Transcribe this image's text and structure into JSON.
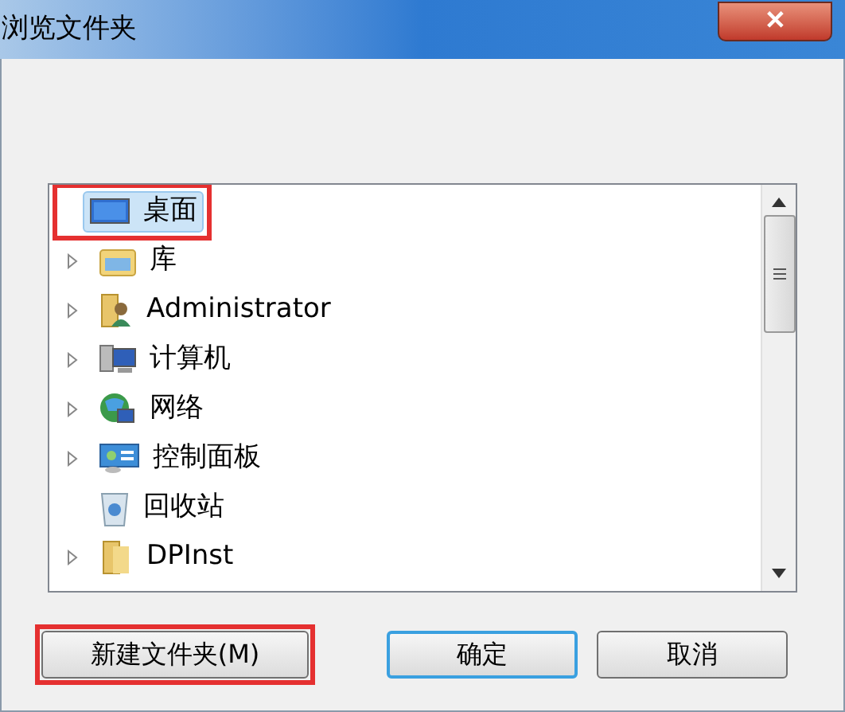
{
  "window": {
    "title": "浏览文件夹",
    "close_label": "✕"
  },
  "tree": {
    "items": [
      {
        "label": "桌面",
        "kind": "desktop",
        "selected": true,
        "expandable": false,
        "highlighted": true
      },
      {
        "label": "库",
        "kind": "library",
        "selected": false,
        "expandable": true,
        "highlighted": false
      },
      {
        "label": "Administrator",
        "kind": "user",
        "selected": false,
        "expandable": true,
        "highlighted": false
      },
      {
        "label": "计算机",
        "kind": "computer",
        "selected": false,
        "expandable": true,
        "highlighted": false
      },
      {
        "label": "网络",
        "kind": "network",
        "selected": false,
        "expandable": true,
        "highlighted": false
      },
      {
        "label": "控制面板",
        "kind": "control-panel",
        "selected": false,
        "expandable": true,
        "highlighted": false
      },
      {
        "label": "回收站",
        "kind": "recycle-bin",
        "selected": false,
        "expandable": false,
        "highlighted": false
      },
      {
        "label": "DPInst",
        "kind": "folder",
        "selected": false,
        "expandable": true,
        "highlighted": false
      }
    ]
  },
  "buttons": [
    {
      "label": "新建文件夹(M)",
      "kind": "new-folder",
      "default": false,
      "highlighted": true
    },
    {
      "label": "确定",
      "kind": "ok",
      "default": true,
      "highlighted": false
    },
    {
      "label": "取消",
      "kind": "cancel",
      "default": false,
      "highlighted": false
    }
  ]
}
